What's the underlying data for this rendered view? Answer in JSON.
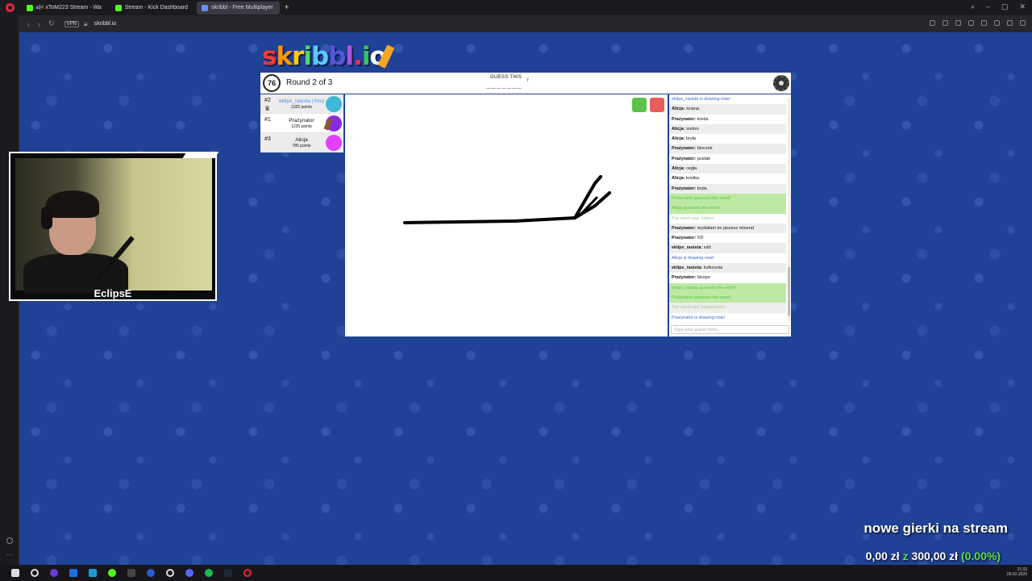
{
  "browser": {
    "tabs": [
      {
        "label": "ɕ|< xToM223 Stream - Wa",
        "color": "#53fc18",
        "active": false
      },
      {
        "label": "Stream - Kick Dashboard",
        "color": "#53fc18",
        "active": false
      },
      {
        "label": "skribbl - Free Multiplayer",
        "color": "#6a8cf0",
        "active": true
      }
    ],
    "new_tab": "+",
    "vpn": "VPN",
    "url": "skribbl.io"
  },
  "game": {
    "logo": "skribbl.io",
    "logo_colors": [
      "#ff3b30",
      "#ff9500",
      "#ffcc00",
      "#4cd964",
      "#5ac8fa",
      "#5856d6",
      "#af52de",
      "#ff2d55",
      "#34c759",
      "#fff"
    ],
    "timer": "76",
    "round": "Round 2 of 3",
    "guess_label": "GUESS THIS",
    "hint": "_______",
    "word_length": "7",
    "players": [
      {
        "rank": "#2",
        "name": "eklips_rasista (You)",
        "points": "1025 points",
        "you": true,
        "avatar_color": "#3fb8d6",
        "crown": "♛"
      },
      {
        "rank": "#1",
        "name": "Prażynator",
        "points": "1235 points",
        "you": false,
        "avatar_color": "#8a2be2",
        "crown": ""
      },
      {
        "rank": "#3",
        "name": "Alicja",
        "points": "785 points",
        "you": false,
        "avatar_color": "#e040fb",
        "crown": ""
      }
    ],
    "chat": [
      {
        "type": "blue",
        "text": "eklips_rasista is drawing now!"
      },
      {
        "type": "msg",
        "user": "Alicja:",
        "text": "ściana"
      },
      {
        "type": "msg",
        "user": "Prażynator:",
        "text": "kreda"
      },
      {
        "type": "msg",
        "user": "Alicja:",
        "text": "srebro"
      },
      {
        "type": "msg",
        "user": "Alicja:",
        "text": "bryła"
      },
      {
        "type": "msg",
        "user": "Prażynator:",
        "text": "bloczek"
      },
      {
        "type": "msg",
        "user": "Prażynator:",
        "text": "pustak"
      },
      {
        "type": "msg",
        "user": "Alicja:",
        "text": "cegła"
      },
      {
        "type": "msg",
        "user": "Alicja:",
        "text": "kostka"
      },
      {
        "type": "msg",
        "user": "Prażynator:",
        "text": "bryła"
      },
      {
        "type": "green",
        "text": "Prażynator guessed the word!"
      },
      {
        "type": "green",
        "text": "Alicja guessed the word!"
      },
      {
        "type": "gray",
        "text": "The word was 'żelazo'"
      },
      {
        "type": "msg",
        "user": "Prażynator:",
        "text": "myślałam że piszesz minerał"
      },
      {
        "type": "msg",
        "user": "Prażynator:",
        "text": "XD"
      },
      {
        "type": "msg",
        "user": "eklips_rasista:",
        "text": "xdd"
      },
      {
        "type": "blue",
        "text": "Alicja is drawing now!"
      },
      {
        "type": "msg",
        "user": "eklips_rasista:",
        "text": "kulturysta"
      },
      {
        "type": "msg",
        "user": "Prażynator:",
        "text": "biceps"
      },
      {
        "type": "green",
        "text": "eklips_rasista guessed the word!"
      },
      {
        "type": "green",
        "text": "Prażynator guessed the word!"
      },
      {
        "type": "gray",
        "text": "The word was 'spadochron'"
      },
      {
        "type": "blue",
        "text": "Prażynator is drawing now!"
      }
    ],
    "chat_placeholder": "Type your guess here..."
  },
  "stream": {
    "cam_name": "EclipsE",
    "overlay_title": "nowe gierki na stream",
    "goal_current": "0,00 zł",
    "goal_sep": "z",
    "goal_target": "300,00 zł",
    "goal_percent": "(0.00%)"
  },
  "taskbar": {
    "time": "21:33",
    "date": "09.02.2026"
  }
}
